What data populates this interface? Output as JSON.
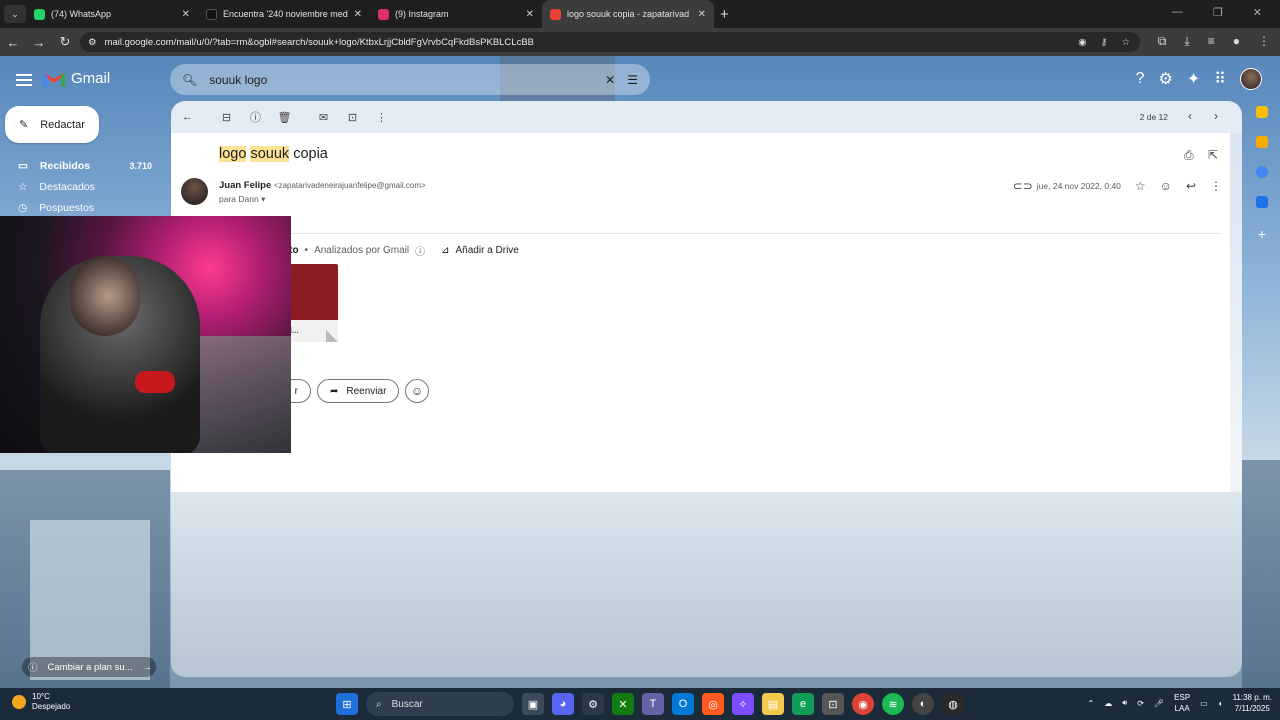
{
  "browser": {
    "tabs": [
      {
        "title": "(74) WhatsApp",
        "color": "#25d366",
        "active": false
      },
      {
        "title": "Encuentra '240 noviembre med",
        "color": "#111111",
        "active": false
      },
      {
        "title": "(9) Instagram",
        "color": "#e1306c",
        "active": false
      },
      {
        "title": "logo souuk copia - zapatarivad",
        "color": "#ea4335",
        "active": true
      }
    ],
    "url": "mail.google.com/mail/u/0/?tab=rm&ogbl#search/souuk+logo/KtbxLrjjCbldFgVrvbCqFkdBsPKBLCLcBB"
  },
  "gmail": {
    "app_name": "Gmail",
    "search_query": "souuk logo",
    "compose_label": "Redactar",
    "nav": [
      {
        "label": "Recibidos",
        "count": "3.710",
        "bold": true
      },
      {
        "label": "Destacados",
        "count": "",
        "bold": false
      },
      {
        "label": "Pospuestos",
        "count": "",
        "bold": false
      }
    ],
    "pager": "2 de 12",
    "subject_hl1": "logo",
    "subject_hl2": "souuk",
    "subject_rest": "copia",
    "sender_name": "Juan Felipe",
    "sender_email": "<zapatarivadeneirajuanfelipe@gmail.com>",
    "recipient": "para Dann",
    "date": "jue, 24 nov 2022, 0:40",
    "attach_label": "nto",
    "scanned": "Analizados por Gmail",
    "add_drive": "Añadir a Drive",
    "attachment_caption": "DEN...",
    "reply_fragment": "r",
    "forward_label": "Reenviar"
  },
  "overlay": {
    "switch_label": "Cambiar a plan su..."
  },
  "taskbar": {
    "temp": "10°C",
    "weather": "Despejado",
    "search": "Buscar",
    "lang1": "ESP",
    "lang2": "LAA",
    "time": "11:38 p. m.",
    "date": "7/11/2025"
  }
}
